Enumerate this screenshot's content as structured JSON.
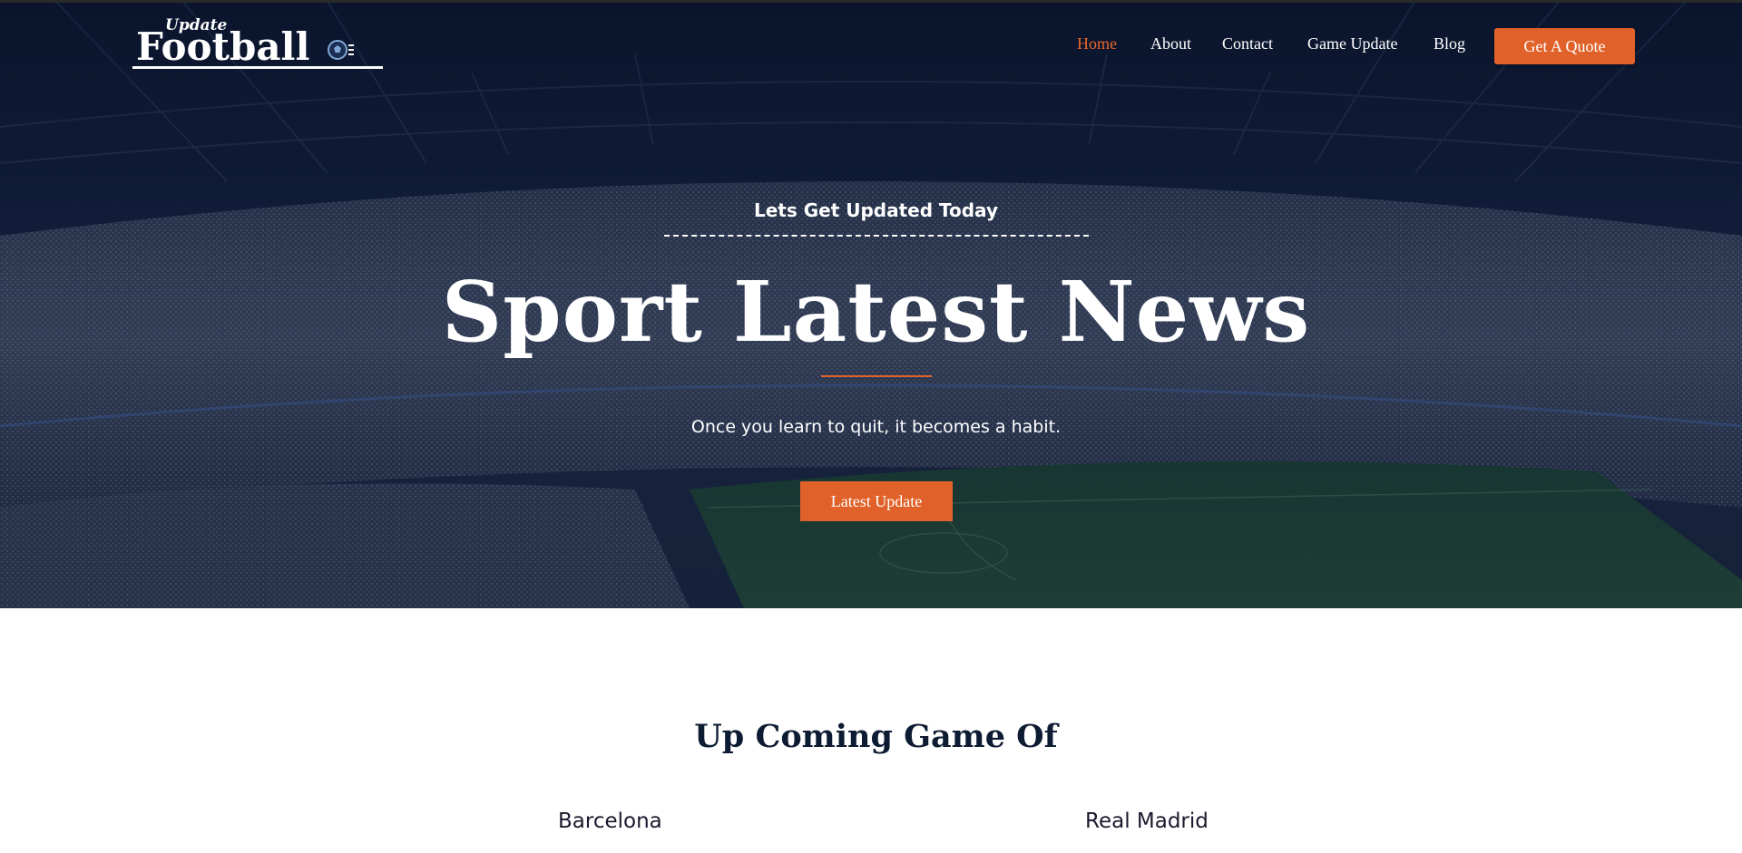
{
  "brand": {
    "logo_small": "Update",
    "logo_main": "Football"
  },
  "nav": {
    "items": [
      {
        "label": "Home",
        "active": true
      },
      {
        "label": "About",
        "active": false
      },
      {
        "label": "Contact",
        "active": false
      },
      {
        "label": "Game Update",
        "active": false
      },
      {
        "label": "Blog",
        "active": false
      }
    ],
    "cta_label": "Get A Quote"
  },
  "hero": {
    "eyebrow": "Lets Get Updated Today",
    "title": "Sport Latest News",
    "subtitle": "Once you learn to quit, it becomes a habit.",
    "button_label": "Latest Update"
  },
  "upcoming": {
    "title": "Up Coming Game Of",
    "teams": [
      "Barcelona",
      "Real Madrid"
    ]
  },
  "colors": {
    "accent": "#e0622a",
    "hero_bg": "#0e1a33",
    "heading_dark": "#0d1b33"
  },
  "icons": {
    "logo_ball": "football-icon"
  }
}
